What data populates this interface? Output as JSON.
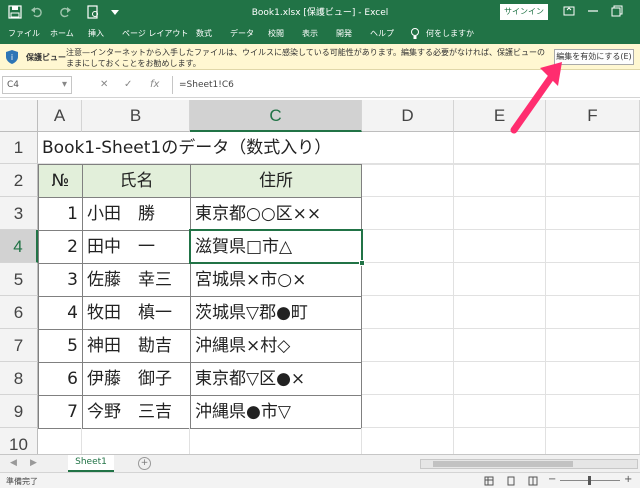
{
  "titlebar": {
    "title": "Book1.xlsx [保護ビュー] - Excel",
    "signin": "サインイン"
  },
  "tabs": [
    "ファイル",
    "ホーム",
    "挿入",
    "ページ レイアウト",
    "数式",
    "データ",
    "校閲",
    "表示",
    "開発",
    "ヘルプ",
    "何をしますか"
  ],
  "protected_view": {
    "title": "保護ビュー",
    "message": "注意—インターネットから入手したファイルは、ウイルスに感染している可能性があります。編集する必要がなければ、保護ビューのままにしておくことをお勧めします。",
    "enable_button": "編集を有効にする(E)"
  },
  "formula_bar": {
    "name_box": "C4",
    "formula": "=Sheet1!C6"
  },
  "grid": {
    "columns": [
      "A",
      "B",
      "C",
      "D",
      "E",
      "F"
    ],
    "rows": [
      "1",
      "2",
      "3",
      "4",
      "5",
      "6",
      "7",
      "8",
      "9",
      "10"
    ],
    "title_cell": "Book1-Sheet1のデータ（数式入り）",
    "header": [
      "№",
      "氏名",
      "住所"
    ],
    "records": [
      {
        "no": "1",
        "name": "小田　勝",
        "address": "東京都○○区××"
      },
      {
        "no": "2",
        "name": "田中　一",
        "address": "滋賀県□市△"
      },
      {
        "no": "3",
        "name": "佐藤　幸三",
        "address": "宮城県×市○×"
      },
      {
        "no": "4",
        "name": "牧田　槙一",
        "address": "茨城県▽郡●町"
      },
      {
        "no": "5",
        "name": "神田　勘吉",
        "address": "沖縄県×村◇"
      },
      {
        "no": "6",
        "name": "伊藤　御子",
        "address": "東京都▽区●×"
      },
      {
        "no": "7",
        "name": "今野　三吉",
        "address": "沖縄県●市▽"
      }
    ]
  },
  "sheet_tabs": {
    "active": "Sheet1",
    "add": "+"
  },
  "status": {
    "ready": "準備完了"
  },
  "colors": {
    "excel_green": "#217346",
    "header_fill": "#e2efda",
    "protected_bar": "#fff7d1",
    "arrow": "#ff2d6f"
  }
}
